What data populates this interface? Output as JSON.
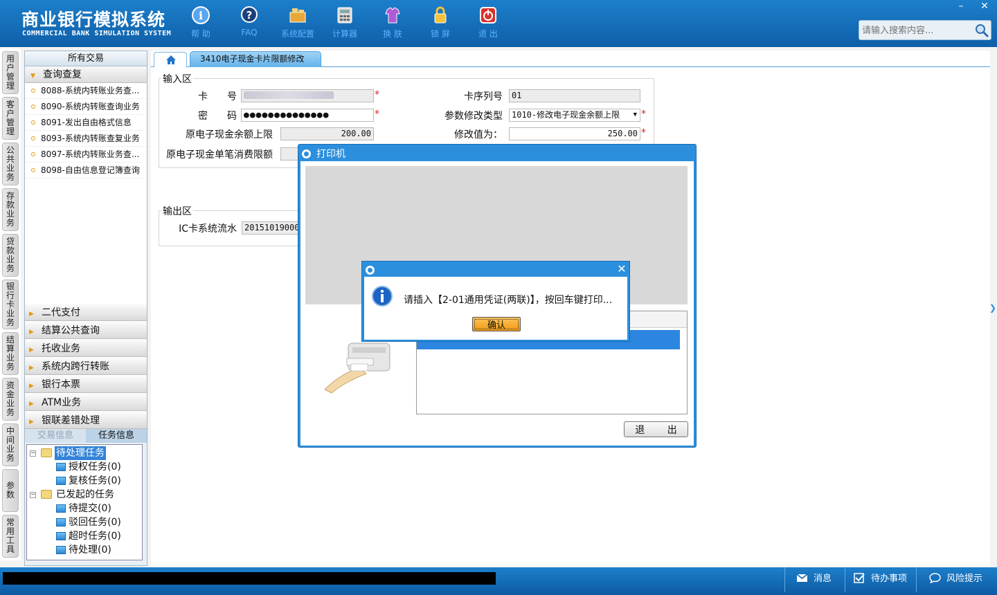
{
  "app": {
    "title_cn": "商业银行模拟系统",
    "title_en": "COMMERCIAL BANK SIMULATION SYSTEM"
  },
  "toolbar": [
    {
      "label": "帮 助",
      "icon": "help-icon"
    },
    {
      "label": "FAQ",
      "icon": "faq-icon"
    },
    {
      "label": "系统配置",
      "icon": "config-icon"
    },
    {
      "label": "计算器",
      "icon": "calculator-icon"
    },
    {
      "label": "换 肤",
      "icon": "skin-icon"
    },
    {
      "label": "锁 屏",
      "icon": "lock-icon"
    },
    {
      "label": "退 出",
      "icon": "exit-icon"
    }
  ],
  "window": {
    "minimize": "–",
    "close": "✕"
  },
  "search": {
    "placeholder": "请输入搜索内容..."
  },
  "vtabs": [
    "用户管理",
    "客户管理",
    "公共业务",
    "存款业务",
    "贷款业务",
    "银行卡业务",
    "结算业务",
    "资金业务",
    "中间业务",
    "参数",
    "常用工具"
  ],
  "nav": {
    "all_label": "所有交易",
    "query_label": "查询查复",
    "items": [
      "8088-系统内转账业务查...",
      "8090-系统内转账查询业务",
      "8091-发出自由格式信息",
      "8093-系统内转账查复业务",
      "8097-系统内转账业务查...",
      "8098-自由信息登记簿查询"
    ],
    "categories": [
      "二代支付",
      "结算公共查询",
      "托收业务",
      "系统内跨行转账",
      "银行本票",
      "ATM业务",
      "银联差错处理"
    ],
    "task_tabs": {
      "trans": "交易信息",
      "task": "任务信息"
    },
    "tree": {
      "pending": "待处理任务",
      "pending_children": [
        "授权任务(0)",
        "复核任务(0)"
      ],
      "initiated": "已发起的任务",
      "initiated_children": [
        "待提交(0)",
        "驳回任务(0)",
        "超时任务(0)",
        "待处理(0)"
      ]
    }
  },
  "tab": {
    "label": "3410电子现金卡片限额修改",
    "close": "×"
  },
  "form": {
    "input_title": "输入区",
    "card_no_label": "卡　　号",
    "password_label": "密　　码",
    "password_value": "●●●●●●●●●●●●●●",
    "orig_limit_label": "原电子现金余额上限",
    "orig_limit_value": "200.00",
    "orig_single_label": "原电子现金单笔消费限额",
    "card_seq_label": "卡序列号",
    "card_seq_value": "01",
    "param_type_label": "参数修改类型",
    "param_type_value": "1010-修改电子现金余额上限",
    "modify_label": "修改值为：",
    "modify_value": "250.00",
    "required_mark": "*",
    "output_title": "输出区",
    "ic_flow_label": "IC卡系统流水",
    "ic_flow_value": "20151019000"
  },
  "printer": {
    "title": "打印机",
    "exit_label": "退 出"
  },
  "message": {
    "text": "请插入【2-01通用凭证(两联)】，按回车键打印...",
    "ok_label": "确认",
    "close": "✕"
  },
  "status": {
    "messages": "消息",
    "todo": "待办事项",
    "risk": "风险提示"
  },
  "colors": {
    "header_blue": "#1277c4",
    "accent_orange": "#f09a12",
    "required_red": "#e02020",
    "selection_blue": "#3383d9"
  }
}
